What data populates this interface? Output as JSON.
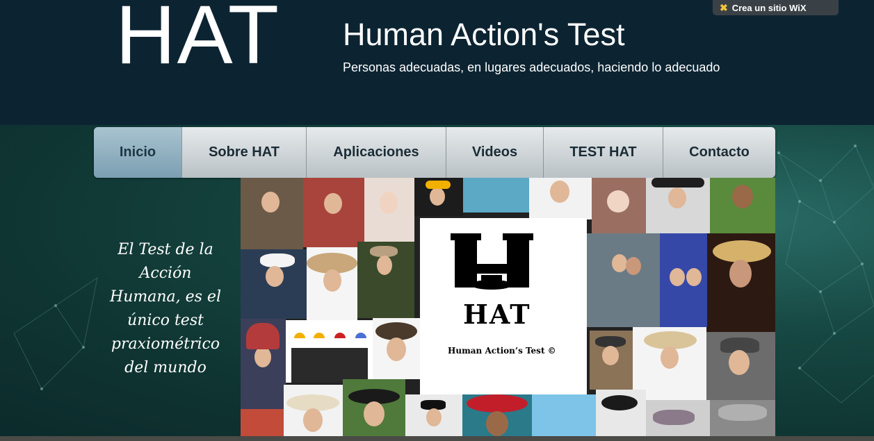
{
  "header": {
    "logo_text": "HAT",
    "title": "Human Action's Test",
    "tagline": "Personas adecuadas, en lugares adecuados, haciendo lo adecuado"
  },
  "wix_badge": {
    "label": "Crea un sitio WiX",
    "icon": "wix-star-icon"
  },
  "nav": {
    "items": [
      {
        "label": "Inicio",
        "active": true
      },
      {
        "label": "Sobre HAT",
        "active": false
      },
      {
        "label": "Aplicaciones",
        "active": false
      },
      {
        "label": "Videos",
        "active": false
      },
      {
        "label": "TEST HAT",
        "active": false
      },
      {
        "label": "Contacto",
        "active": false
      }
    ]
  },
  "quote": "El Test de la Acción Humana, es el único test praxiométrico del mundo",
  "collage": {
    "logo_letters": "HAT",
    "logo_caption": "Human Action’s Test ©"
  },
  "colors": {
    "header_bg": "#0c2432",
    "nav_active": "#8eaebf",
    "nav_bg": "#d0d6d9",
    "wix_star": "#f4c23a"
  }
}
